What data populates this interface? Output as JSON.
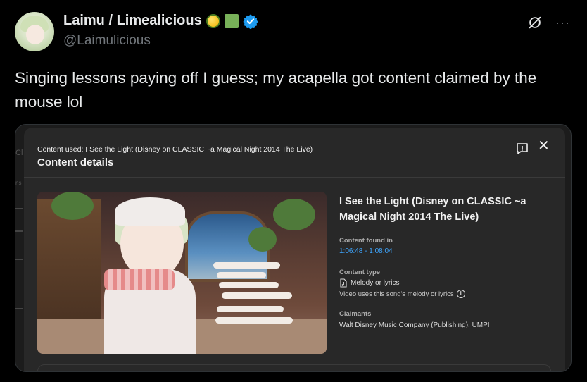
{
  "tweet": {
    "author": {
      "display_name": "Laimu / Limealicious",
      "handle": "@Laimulicious",
      "badges": [
        "lemon-emoji",
        "green-square-emoji",
        "verified-badge"
      ]
    },
    "text": "Singing lessons paying off I guess; my acapella got content claimed by the mouse lol",
    "icons": {
      "grok": "grok-icon",
      "more": "more-icon"
    },
    "more_glyph": "···"
  },
  "dialog": {
    "content_used": "Content used: I See the Light (Disney on CLASSIC ~a Magical Night 2014 The Live)",
    "title": "Content details",
    "close_glyph": "✕",
    "song_title": "I See the Light (Disney on CLASSIC ~a Magical Night 2014 The Live)",
    "content_found_label": "Content found in",
    "content_found_value": "1:06:48 - 1:08:04",
    "content_type_label": "Content type",
    "content_type_value": "Melody or lyrics",
    "content_type_desc": "Video uses this song's melody or lyrics",
    "info_glyph": "i",
    "claimants_label": "Claimants",
    "claimants_value": "Walt Disney Music Company (Publishing), UMPI"
  },
  "background": {
    "letters": [
      "Cl",
      "ns"
    ]
  },
  "colors": {
    "background": "#000000",
    "text": "#e7e9ea",
    "muted": "#71767b",
    "dialog_bg": "#282828",
    "link": "#3ea6ff",
    "verified": "#1d9bf0"
  }
}
